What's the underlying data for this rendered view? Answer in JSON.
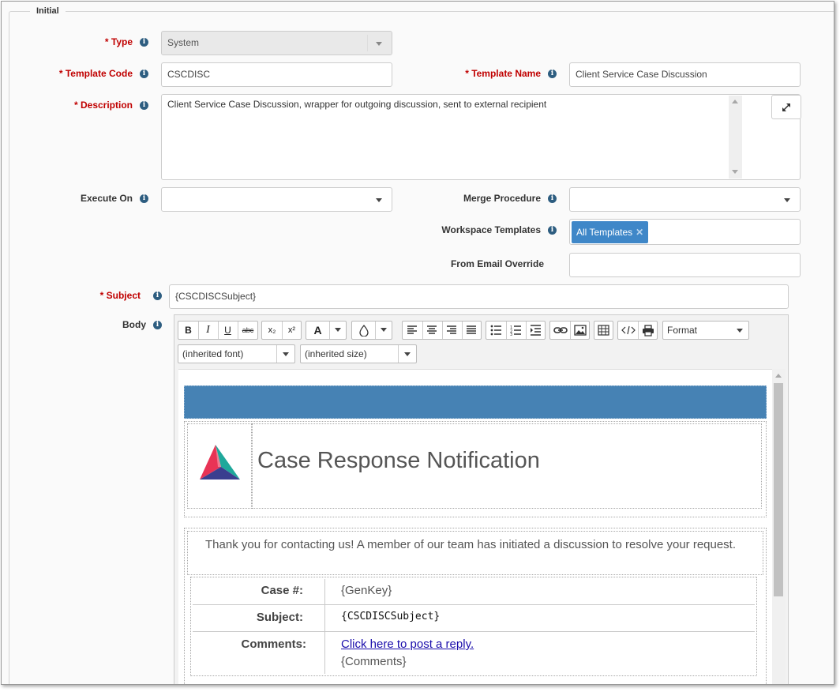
{
  "section_title": "Initial",
  "fields": {
    "type": {
      "label": "* Type",
      "value": "System"
    },
    "template_code": {
      "label": "* Template Code",
      "value": "CSCDISC"
    },
    "template_name": {
      "label": "* Template Name",
      "value": "Client Service Case Discussion"
    },
    "description": {
      "label": "* Description",
      "value": "Client Service Case Discussion, wrapper for outgoing discussion, sent to external recipient"
    },
    "execute_on": {
      "label": "Execute On",
      "value": ""
    },
    "merge_procedure": {
      "label": "Merge Procedure",
      "value": ""
    },
    "workspace_templates": {
      "label": "Workspace Templates",
      "tags": [
        "All Templates"
      ]
    },
    "from_email_override": {
      "label": "From Email Override",
      "value": ""
    },
    "subject": {
      "label": "* Subject",
      "value": "{CSCDISCSubject}"
    },
    "body": {
      "label": "Body"
    }
  },
  "toolbar": {
    "bold": "B",
    "italic": "I",
    "underline": "U",
    "strike": "abc",
    "subscript": "x₂",
    "superscript": "x²",
    "font_color": "A",
    "format_select": "Format",
    "font_select": "(inherited font)",
    "size_select": "(inherited size)"
  },
  "email": {
    "banner_color": "#4682b4",
    "title": "Case Response Notification",
    "intro": "Thank you for contacting us! A member of our team has initiated a discussion to resolve your request.",
    "rows": [
      {
        "label": "Case #:",
        "value": "{GenKey}"
      },
      {
        "label": "Subject:",
        "value": "{CSCDISCSubject}"
      },
      {
        "label": "Comments:",
        "link": "Click here to post a reply.",
        "value": "{Comments}"
      }
    ]
  },
  "colors": {
    "required": "#c00000",
    "info_icon": "#2d5d80",
    "tag": "#3f87c8"
  }
}
